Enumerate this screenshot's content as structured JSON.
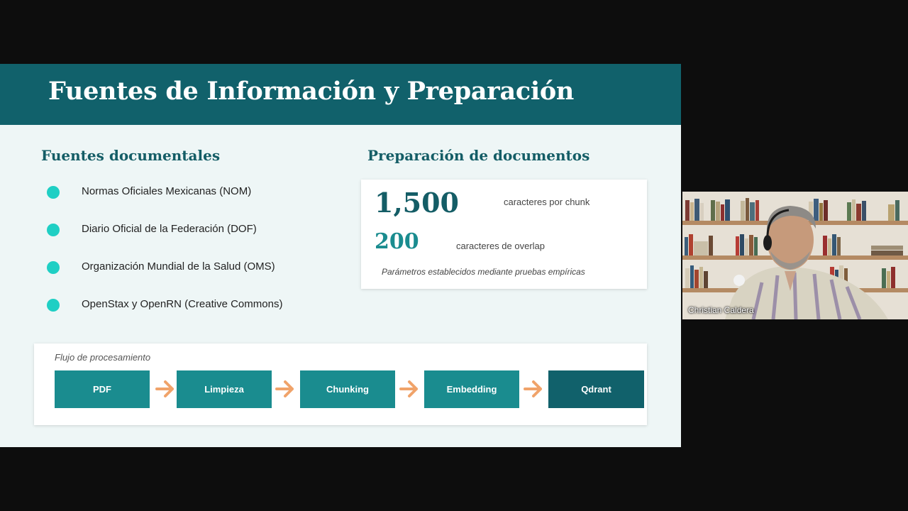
{
  "slide": {
    "title": "Fuentes de Información y Preparación",
    "sources": {
      "heading": "Fuentes documentales",
      "items": [
        "Normas Oficiales Mexicanas (NOM)",
        "Diario Oficial de la Federación (DOF)",
        "Organización Mundial de la Salud (OMS)",
        "OpenStax y OpenRN (Creative Commons)"
      ]
    },
    "preparation": {
      "heading": "Preparación de documentos",
      "chunk_size": "1,500",
      "chunk_label": "caracteres por chunk",
      "overlap": "200",
      "overlap_label": "caracteres de overlap",
      "note": "Parámetros establecidos mediante pruebas empíricas"
    },
    "flow": {
      "caption": "Flujo de procesamiento",
      "steps": [
        "PDF",
        "Limpieza",
        "Chunking",
        "Embedding",
        "Qdrant"
      ]
    }
  },
  "video": {
    "participant_name": "Christian Caldera"
  },
  "colors": {
    "title_bar": "#11616b",
    "slide_bg": "#eef6f6",
    "heading": "#145d66",
    "bullet": "#1fcfc4",
    "step": "#1a8c8f",
    "step_final": "#11616b",
    "arrow": "#f0a36a"
  },
  "icons": {
    "bullet": "dot-icon",
    "flow_separator": "arrow-right-icon"
  }
}
